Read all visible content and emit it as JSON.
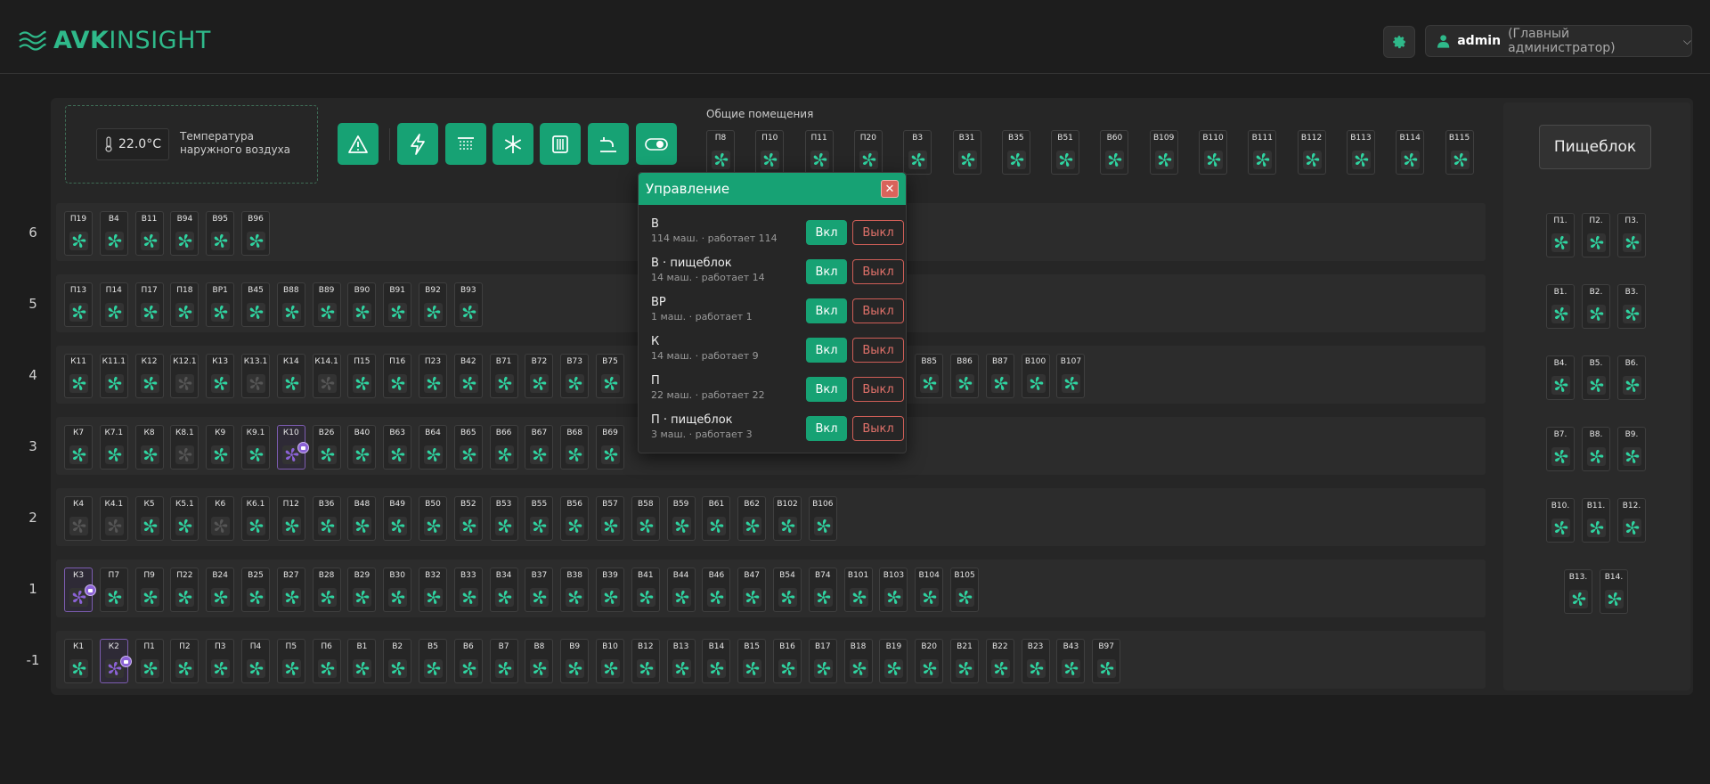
{
  "header": {
    "logo_bold": "AVK",
    "logo_light": "INSIGHT",
    "username": "admin",
    "role": "(Главный администратор)"
  },
  "controls": {
    "temperature": "22.0°C",
    "temperature_label_line1": "Температура",
    "temperature_label_line2": "наружного воздуха",
    "common_title": "Общие помещения"
  },
  "common_units": [
    "П8",
    "П10",
    "П11",
    "П20",
    "В3",
    "В31",
    "В35",
    "В51",
    "В60",
    "В109",
    "В110",
    "В111",
    "В112",
    "В113",
    "В114",
    "В115"
  ],
  "right_card": "Пищеблок",
  "floors": [
    {
      "label": "6",
      "units": [
        "П19",
        "В4",
        "В11",
        "В94",
        "В95",
        "В96"
      ]
    },
    {
      "label": "5",
      "units": [
        "П13",
        "П14",
        "П17",
        "П18",
        "ВР1",
        "В45",
        "В88",
        "В89",
        "В90",
        "В91",
        "В92",
        "В93"
      ]
    },
    {
      "label": "4",
      "units": [
        "К11",
        "К11.1",
        "К12",
        "К12.1",
        "К13",
        "К13.1",
        "К14",
        "К14.1",
        "П15",
        "П16",
        "П23",
        "В42",
        "В71",
        "В72",
        "В73",
        "В75",
        "",
        "",
        "",
        "",
        "",
        "",
        "",
        "",
        "В85",
        "В86",
        "В87",
        "В100",
        "В107"
      ]
    },
    {
      "label": "3",
      "units": [
        "К7",
        "К7.1",
        "К8",
        "К8.1",
        "К9",
        "К9.1",
        "К10",
        "В26",
        "В40",
        "В63",
        "В64",
        "В65",
        "В66",
        "В67",
        "В68",
        "В69",
        "",
        "",
        ""
      ]
    },
    {
      "label": "2",
      "units": [
        "К4",
        "К4.1",
        "К5",
        "К5.1",
        "К6",
        "К6.1",
        "П12",
        "В36",
        "В48",
        "В49",
        "В50",
        "В52",
        "В53",
        "В55",
        "В56",
        "В57",
        "В58",
        "В59",
        "В61",
        "В62",
        "В102",
        "В106"
      ]
    },
    {
      "label": "1",
      "units": [
        "К3",
        "П7",
        "П9",
        "П22",
        "В24",
        "В25",
        "В27",
        "В28",
        "В29",
        "В30",
        "В32",
        "В33",
        "В34",
        "В37",
        "В38",
        "В39",
        "В41",
        "В44",
        "В46",
        "В47",
        "В54",
        "В74",
        "В101",
        "В103",
        "В104",
        "В105"
      ]
    },
    {
      "label": "-1",
      "units": [
        "К1",
        "К2",
        "П1",
        "П2",
        "П3",
        "П4",
        "П5",
        "П6",
        "В1",
        "В2",
        "В5",
        "В6",
        "В7",
        "В8",
        "В9",
        "В10",
        "В12",
        "В13",
        "В14",
        "В15",
        "В16",
        "В17",
        "В18",
        "В19",
        "В20",
        "В21",
        "В22",
        "В23",
        "В43",
        "В97"
      ]
    }
  ],
  "right_units": [
    [
      "П1.",
      "П2.",
      "П3."
    ],
    [
      "В1.",
      "В2.",
      "В3."
    ],
    [
      "В4.",
      "В5.",
      "В6."
    ],
    [
      "В7.",
      "В8.",
      "В9."
    ],
    [
      "В10.",
      "В11.",
      "В12."
    ],
    [
      "В13.",
      "В14."
    ]
  ],
  "colors": {
    "accent": "#17a274",
    "fan_on": "#2fd3a0",
    "fan_off": "#555555",
    "highlight": "#8b62d6",
    "danger": "#cf5e57"
  },
  "modal": {
    "title": "Управление",
    "close": "✕",
    "on_label": "Вкл",
    "off_label": "Выкл",
    "rows": [
      {
        "name": "В",
        "desc": "114 маш. · работает 114"
      },
      {
        "name": "В · пищеблок",
        "desc": "14 маш. · работает 14"
      },
      {
        "name": "ВР",
        "desc": "1 маш. · работает 1"
      },
      {
        "name": "К",
        "desc": "14 маш. · работает 9"
      },
      {
        "name": "П",
        "desc": "22 маш. · работает 22"
      },
      {
        "name": "П · пищеблок",
        "desc": "3 маш. · работает 3"
      }
    ]
  }
}
